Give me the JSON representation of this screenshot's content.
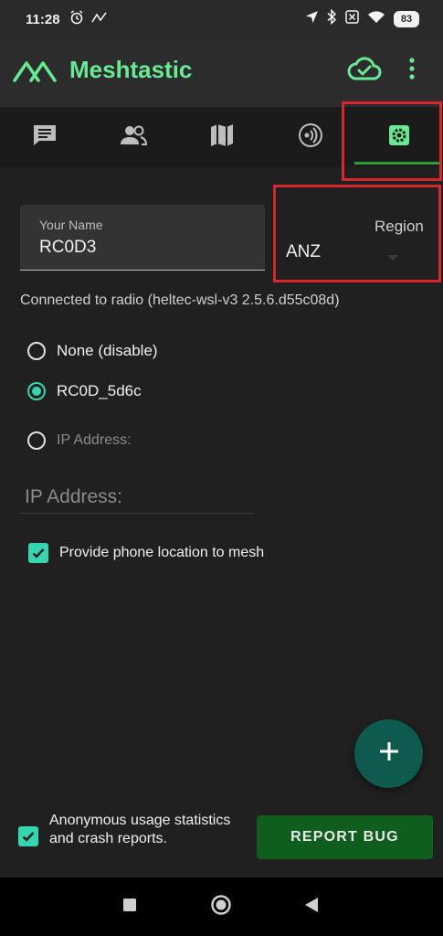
{
  "status_bar": {
    "time": "11:28",
    "battery": "83",
    "icons_left": [
      "alarm-icon",
      "signal-graph-icon"
    ],
    "icons_right": [
      "location-arrow-icon",
      "bluetooth-icon",
      "sim-x-icon",
      "wifi-icon",
      "battery-icon"
    ]
  },
  "app_bar": {
    "title": "Meshtastic",
    "brand_color": "#67ea94"
  },
  "tabs": [
    {
      "icon": "chat-icon"
    },
    {
      "icon": "people-icon"
    },
    {
      "icon": "map-icon"
    },
    {
      "icon": "radio-wave-icon"
    },
    {
      "icon": "settings-icon",
      "selected": true
    }
  ],
  "settings": {
    "your_name_label": "Your Name",
    "your_name_value": "RC0D3",
    "region_label": "Region",
    "region_value": "ANZ",
    "connected_text": "Connected to radio (heltec-wsl-v3 2.5.6.d55c08d)",
    "radio_options": [
      {
        "label": "None (disable)",
        "selected": false
      },
      {
        "label": "RC0D_5d6c",
        "selected": true
      },
      {
        "label": "IP Address:",
        "selected": false
      }
    ],
    "ip_address_placeholder": "IP Address:",
    "provide_location_label": "Provide phone location to mesh",
    "provide_location_checked": true
  },
  "footer": {
    "anonymous_label": "Anonymous usage statistics and crash reports.",
    "anonymous_checked": true,
    "report_bug_label": "REPORT BUG"
  },
  "colors": {
    "accent_teal": "#33d6b1",
    "highlight_red": "#d7262c",
    "report_bug_bg": "#0f5e1d",
    "fab_bg": "#0e5a4e"
  }
}
